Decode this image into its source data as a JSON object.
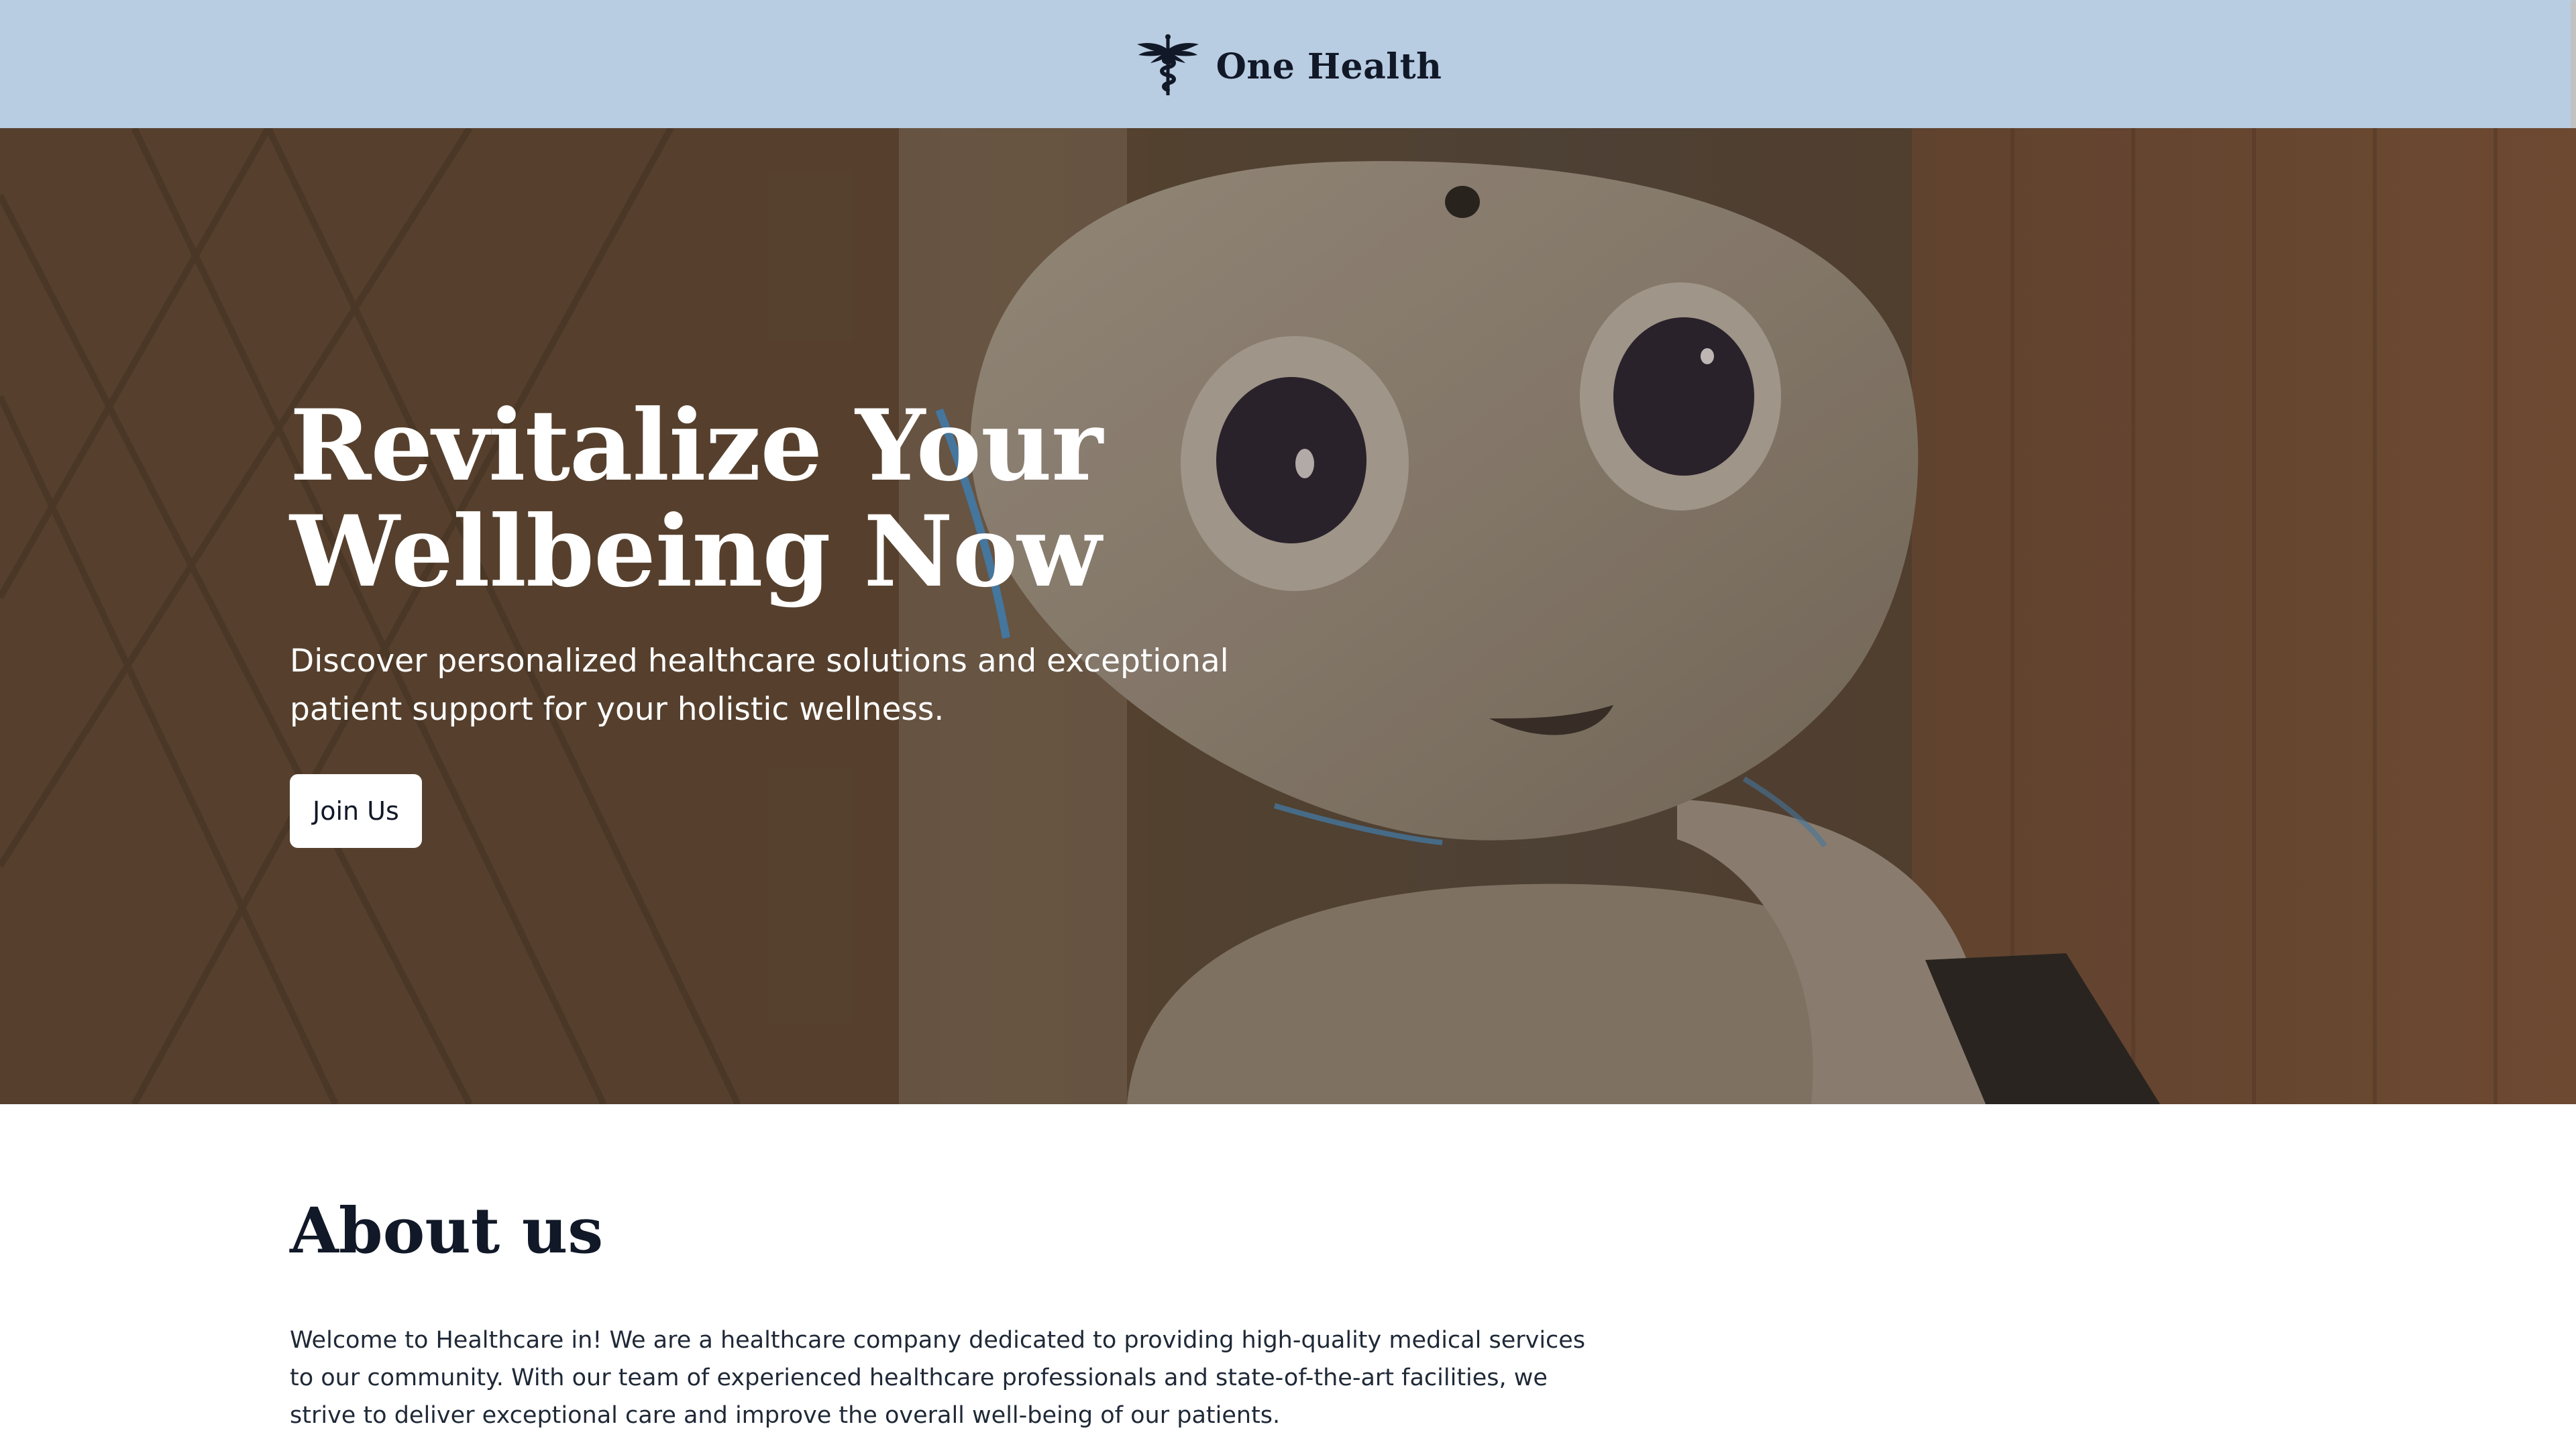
{
  "header": {
    "brand_name": "One Health",
    "logo_icon": "caduceus-icon",
    "background_color": "#b8cce2"
  },
  "hero": {
    "title_line1": "Revitalize Your",
    "title_line2": "Wellbeing Now",
    "subtitle": "Discover personalized healthcare solutions and exceptional patient support for your holistic wellness.",
    "cta_label": "Join Us",
    "background_image": "robot-photo"
  },
  "about": {
    "title": "About us",
    "text": "Welcome to Healthcare in! We are a healthcare company dedicated to providing high-quality medical services to our community. With our team of experienced healthcare professionals and state-of-the-art facilities, we strive to deliver exceptional care and improve the overall well-being of our patients."
  },
  "colors": {
    "text_dark": "#111827",
    "button_bg": "#ffffff"
  }
}
